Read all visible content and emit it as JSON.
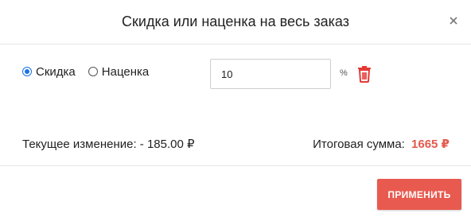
{
  "dialog": {
    "title": "Скидка или наценка на весь заказ",
    "close_icon": "close-icon"
  },
  "adjustment": {
    "options": [
      {
        "label": "Скидка",
        "checked": true
      },
      {
        "label": "Наценка",
        "checked": false
      }
    ],
    "value": "10",
    "unit": "%",
    "delete_icon": "trash-icon"
  },
  "summary": {
    "current_change": "Текущее изменение: - 185.00 ₽",
    "total_label": "Итоговая сумма:",
    "total_value": "1665 ₽"
  },
  "footer": {
    "apply_label": "ПРИМЕНИТЬ"
  },
  "colors": {
    "accent": "#e85a4f",
    "total_value": "#e35a4d",
    "radio_checked": "#1a73e8",
    "trash": "#e53935"
  }
}
